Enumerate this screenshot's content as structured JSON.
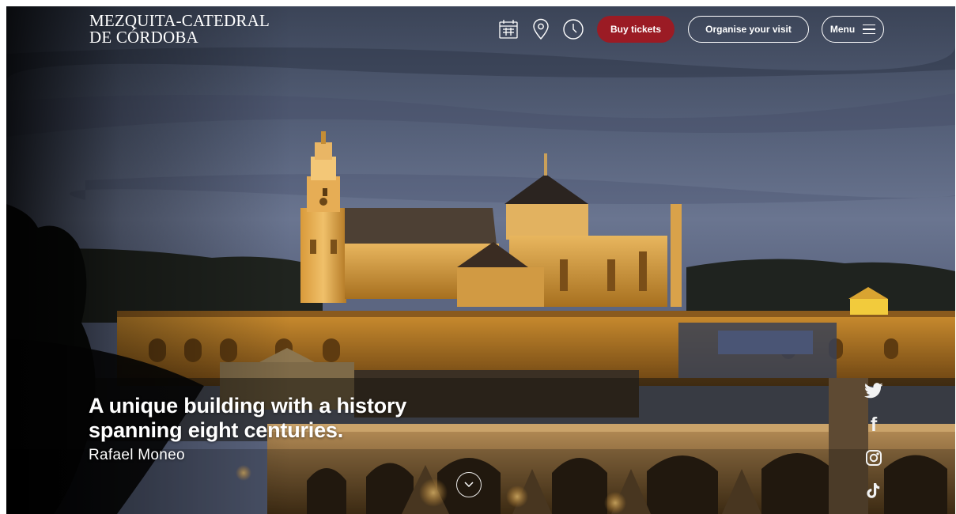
{
  "site": {
    "logo_line1": "MEZQUITA-CATEDRAL",
    "logo_line2": "DE CÓRDOBA"
  },
  "header": {
    "icons": [
      "calendar-icon",
      "location-pin-icon",
      "clock-icon"
    ],
    "buy_tickets_label": "Buy tickets",
    "organise_visit_label": "Organise your visit",
    "menu_label": "Menu"
  },
  "hero": {
    "quote": "A unique building with a history spanning eight centuries.",
    "author": "Rafael Moneo"
  },
  "social": [
    "twitter-icon",
    "facebook-icon",
    "instagram-icon",
    "tiktok-icon"
  ],
  "colors": {
    "accent": "#9b1b24",
    "text": "#ffffff"
  }
}
